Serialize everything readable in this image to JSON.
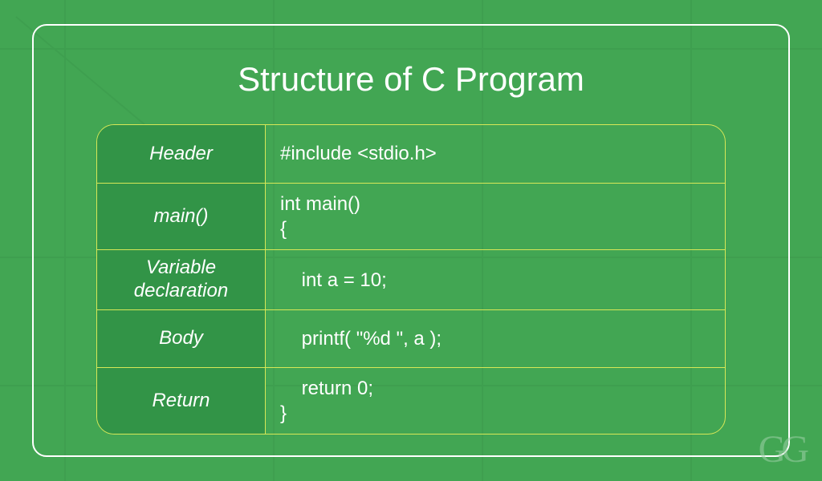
{
  "title": "Structure of C Program",
  "rows": [
    {
      "label": "Header",
      "code": "#include <stdio.h>"
    },
    {
      "label": "main()",
      "code": "int main()\n{"
    },
    {
      "label": "Variable\ndeclaration",
      "code": "    int a = 10;"
    },
    {
      "label": "Body",
      "code": "    printf( \"%d \", a );"
    },
    {
      "label": "Return",
      "code": "    return 0;\n}"
    }
  ],
  "logo": "GG"
}
